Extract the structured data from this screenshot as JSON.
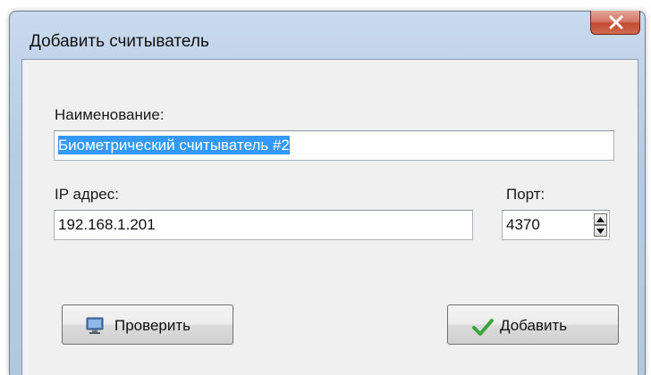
{
  "window": {
    "title": "Добавить считыватель"
  },
  "form": {
    "name_label": "Наименование:",
    "name_value": "Биометрический считыватель #2",
    "ip_label": "IP адрес:",
    "ip_value": "192.168.1.201",
    "port_label": "Порт:",
    "port_value": "4370"
  },
  "buttons": {
    "check_label": "Проверить",
    "check_icon": "monitor-icon",
    "add_label": "Добавить",
    "add_icon": "checkmark-icon"
  },
  "colors": {
    "selection": "#3399ff",
    "close_button": "#c34a32",
    "checkmark": "#3aa43a"
  }
}
